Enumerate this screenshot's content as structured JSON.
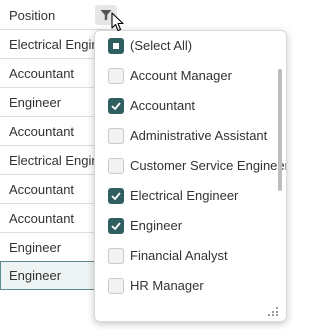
{
  "grid": {
    "header": {
      "label": "Position"
    },
    "rows": [
      "Electrical Engineer",
      "Accountant",
      "Engineer",
      "Accountant",
      "Electrical Engineer",
      "Accountant",
      "Accountant",
      "Engineer",
      "Engineer"
    ]
  },
  "filter_popup": {
    "items": [
      {
        "label": "(Select All)",
        "state": "partial"
      },
      {
        "label": "Account Manager",
        "state": "unchecked"
      },
      {
        "label": "Accountant",
        "state": "checked"
      },
      {
        "label": "Administrative Assistant",
        "state": "unchecked"
      },
      {
        "label": "Customer Service Engineer",
        "state": "unchecked"
      },
      {
        "label": "Electrical Engineer",
        "state": "checked"
      },
      {
        "label": "Engineer",
        "state": "checked"
      },
      {
        "label": "Financial Analyst",
        "state": "unchecked"
      },
      {
        "label": "HR Manager",
        "state": "unchecked"
      }
    ]
  },
  "icons": {
    "filter": "filter-icon",
    "check": "check-icon",
    "resize": "resize-grip-icon",
    "cursor": "mouse-pointer-icon"
  },
  "colors": {
    "accent": "#2f5f60",
    "focused_border": "#5f8a8b",
    "grid_border": "#dddddd",
    "filter_button_bg": "#e6e6e6"
  }
}
